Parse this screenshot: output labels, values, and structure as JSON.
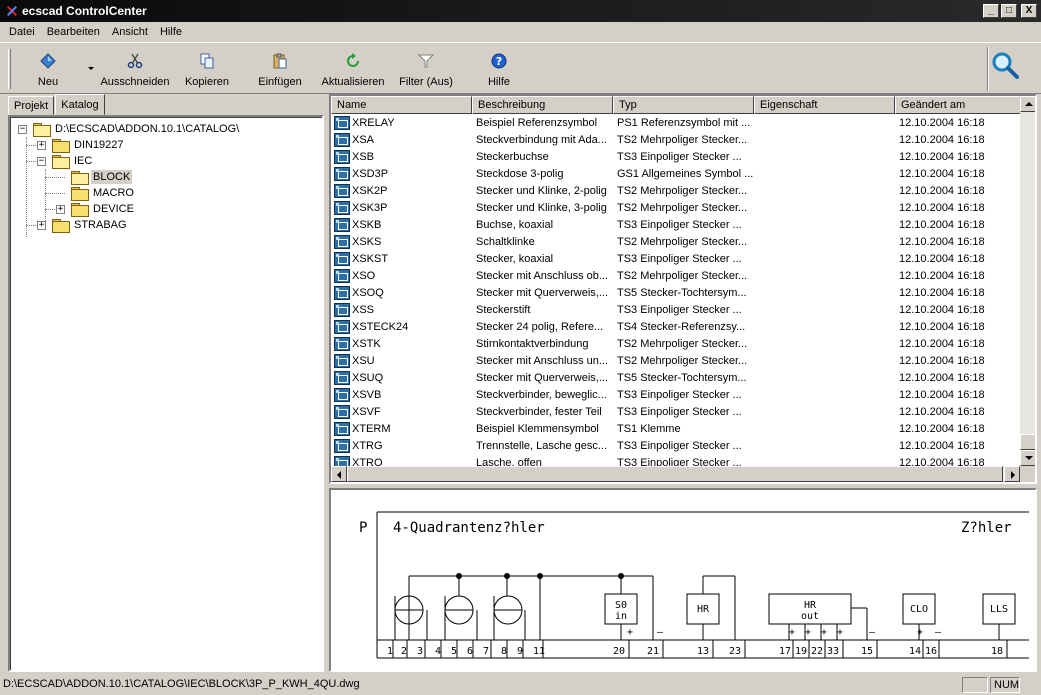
{
  "window": {
    "title": "ecscad ControlCenter",
    "minimize": "_",
    "maximize": "□",
    "close": "X"
  },
  "menu": [
    "Datei",
    "Bearbeiten",
    "Ansicht",
    "Hilfe"
  ],
  "toolbar": {
    "new": "Neu",
    "cut": "Ausschneiden",
    "copy": "Kopieren",
    "paste": "Einfügen",
    "refresh": "Aktualisieren",
    "filter": "Filter (Aus)",
    "help": "Hilfe"
  },
  "tabs": [
    "Projekt",
    "Katalog"
  ],
  "tree": {
    "root": "D:\\ECSCAD\\ADDON.10.1\\CATALOG\\",
    "items": [
      "DIN19227",
      "IEC",
      "BLOCK",
      "MACRO",
      "DEVICE",
      "STRABAG"
    ]
  },
  "list": {
    "columns": [
      "Name",
      "Beschreibung",
      "Typ",
      "Eigenschaft",
      "Geändert am"
    ],
    "rows": [
      [
        "XRELAY",
        "Beispiel Referenzsymbol",
        "PS1 Referenzsymbol mit ...",
        "",
        "12.10.2004 16:18"
      ],
      [
        "XSA",
        "Steckverbindung mit Ada...",
        "TS2 Mehrpoliger Stecker...",
        "",
        "12.10.2004 16:18"
      ],
      [
        "XSB",
        "Steckerbuchse",
        "TS3 Einpoliger Stecker  ...",
        "",
        "12.10.2004 16:18"
      ],
      [
        "XSD3P",
        "Steckdose 3-polig",
        "GS1 Allgemeines Symbol ...",
        "",
        "12.10.2004 16:18"
      ],
      [
        "XSK2P",
        "Stecker und Klinke, 2-polig",
        "TS2 Mehrpoliger Stecker...",
        "",
        "12.10.2004 16:18"
      ],
      [
        "XSK3P",
        "Stecker und Klinke, 3-polig",
        "TS2 Mehrpoliger Stecker...",
        "",
        "12.10.2004 16:18"
      ],
      [
        "XSKB",
        "Buchse, koaxial",
        "TS3 Einpoliger Stecker  ...",
        "",
        "12.10.2004 16:18"
      ],
      [
        "XSKS",
        "Schaltklinke",
        "TS2 Mehrpoliger Stecker...",
        "",
        "12.10.2004 16:18"
      ],
      [
        "XSKST",
        "Stecker, koaxial",
        "TS3 Einpoliger Stecker  ...",
        "",
        "12.10.2004 16:18"
      ],
      [
        "XSO",
        "Stecker mit Anschluss ob...",
        "TS2 Mehrpoliger Stecker...",
        "",
        "12.10.2004 16:18"
      ],
      [
        "XSOQ",
        "Stecker mit Querverweis,...",
        "TS5 Stecker-Tochtersym...",
        "",
        "12.10.2004 16:18"
      ],
      [
        "XSS",
        "Steckerstift",
        "TS3 Einpoliger Stecker  ...",
        "",
        "12.10.2004 16:18"
      ],
      [
        "XSTECK24",
        "Stecker 24 polig, Refere...",
        "TS4 Stecker-Referenzsy...",
        "",
        "12.10.2004 16:18"
      ],
      [
        "XSTK",
        "Stirnkontaktverbindung",
        "TS2 Mehrpoliger Stecker...",
        "",
        "12.10.2004 16:18"
      ],
      [
        "XSU",
        "Stecker mit Anschluss un...",
        "TS2 Mehrpoliger Stecker...",
        "",
        "12.10.2004 16:18"
      ],
      [
        "XSUQ",
        "Stecker mit Querverweis,...",
        "TS5 Stecker-Tochtersym...",
        "",
        "12.10.2004 16:18"
      ],
      [
        "XSVB",
        "Steckverbinder, beweglic...",
        "TS3 Einpoliger Stecker  ...",
        "",
        "12.10.2004 16:18"
      ],
      [
        "XSVF",
        "Steckverbinder, fester Teil",
        "TS3 Einpoliger Stecker  ...",
        "",
        "12.10.2004 16:18"
      ],
      [
        "XTERM",
        "Beispiel Klemmensymbol",
        "TS1 Klemme",
        "",
        "12.10.2004 16:18"
      ],
      [
        "XTRG",
        "Trennstelle, Lasche gesc...",
        "TS3 Einpoliger Stecker  ...",
        "",
        "12.10.2004 16:18"
      ],
      [
        "XTRO",
        "Lasche, offen",
        "TS3 Einpoliger Stecker  ...",
        "",
        "12.10.2004 16:18"
      ]
    ]
  },
  "preview": {
    "left_letter": "P",
    "title": "4-Quadrantenz?hler",
    "right_title": "Z?hler",
    "boxes": [
      "S0",
      "in",
      "HR",
      "HR",
      "out",
      "CLO",
      "LLS"
    ],
    "terminals": [
      "1",
      "2",
      "3",
      "4",
      "5",
      "6",
      "7",
      "8",
      "9",
      "11",
      "20",
      "21",
      "13",
      "23",
      "17",
      "19",
      "22",
      "33",
      "15",
      "14",
      "16",
      "18"
    ],
    "plus": "+",
    "minus": "–"
  },
  "status": {
    "path": "D:\\ECSCAD\\ADDON.10.1\\CATALOG\\IEC\\BLOCK\\3P_P_KWH_4QU.dwg",
    "num": "NUM"
  }
}
